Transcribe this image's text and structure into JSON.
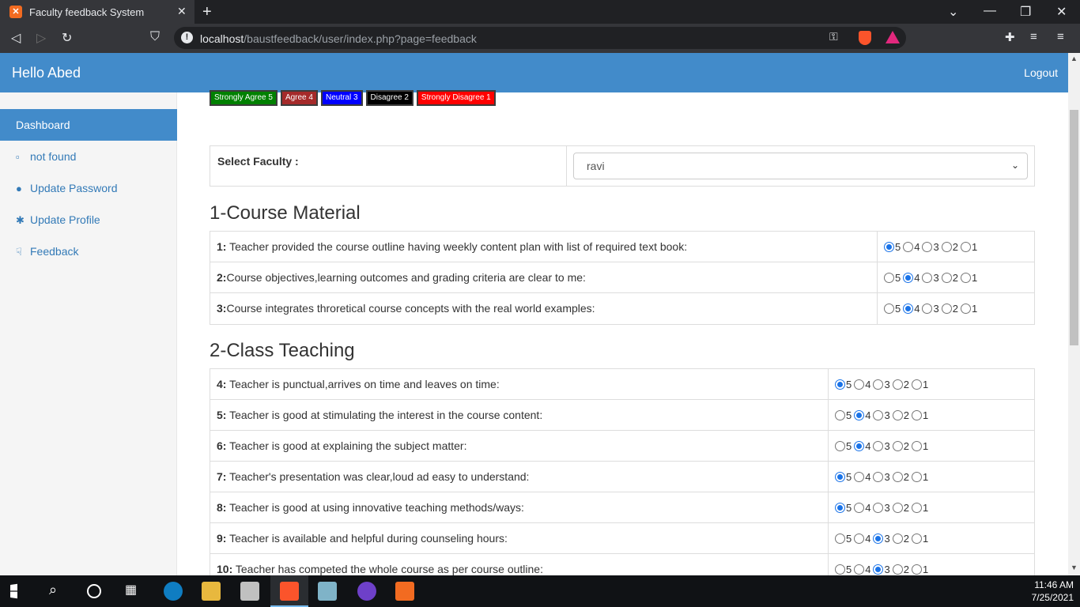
{
  "browser": {
    "tab_title": "Faculty feedback System",
    "url_host": "localhost",
    "url_path": "/baustfeedback/user/index.php?page=feedback"
  },
  "header": {
    "greeting": "Hello Abed",
    "logout": "Logout"
  },
  "sidebar": {
    "items": [
      {
        "label": "Dashboard"
      },
      {
        "label": "not found"
      },
      {
        "label": "Update Password"
      },
      {
        "label": "Update Profile"
      },
      {
        "label": "Feedback"
      }
    ]
  },
  "legend": [
    {
      "label": "Strongly Agree 5",
      "color": "#008000"
    },
    {
      "label": "Agree 4",
      "color": "#a52a2a"
    },
    {
      "label": "Neutral 3",
      "color": "#0000ff"
    },
    {
      "label": "Disagree 2",
      "color": "#000000"
    },
    {
      "label": "Strongly Disagree 1",
      "color": "#ff0000"
    }
  ],
  "faculty": {
    "label": "Select Faculty :",
    "selected": "ravi"
  },
  "sections": [
    {
      "title": "1-Course Material",
      "questions": [
        {
          "num": "1:",
          "text": " Teacher provided the course outline having weekly content plan with list of required text book:",
          "selected": 5
        },
        {
          "num": "2:",
          "text": "Course objectives,learning outcomes and grading criteria are clear to me:",
          "selected": 4
        },
        {
          "num": "3:",
          "text": "Course integrates throretical course concepts with the real world examples:",
          "selected": 4
        }
      ]
    },
    {
      "title": "2-Class Teaching",
      "questions": [
        {
          "num": "4:",
          "text": " Teacher is punctual,arrives on time and leaves on time:",
          "selected": 5
        },
        {
          "num": "5:",
          "text": " Teacher is good at stimulating the interest in the course content:",
          "selected": 4
        },
        {
          "num": "6:",
          "text": " Teacher is good at explaining the subject matter:",
          "selected": 4
        },
        {
          "num": "7:",
          "text": " Teacher's presentation was clear,loud ad easy to understand:",
          "selected": 5
        },
        {
          "num": "8:",
          "text": " Teacher is good at using innovative teaching methods/ways:",
          "selected": 5
        },
        {
          "num": "9:",
          "text": " Teacher is available and helpful during counseling hours:",
          "selected": 3
        },
        {
          "num": "10:",
          "text": " Teacher has competed the whole course as per course outline:",
          "selected": 3
        }
      ]
    }
  ],
  "option_labels": [
    "5",
    "4",
    "3",
    "2",
    "1"
  ],
  "taskbar": {
    "time": "11:46 AM",
    "date": "7/25/2021"
  }
}
